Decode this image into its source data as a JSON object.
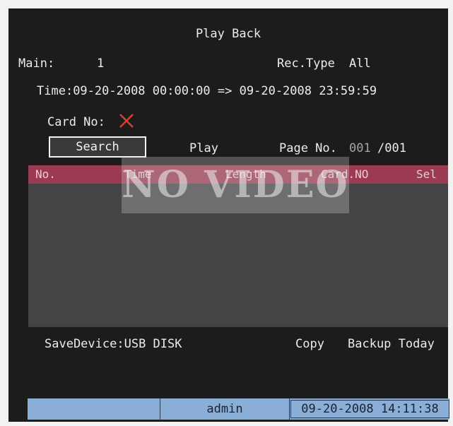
{
  "screen": {
    "title": "Play Back",
    "main_label": "Main:",
    "main_value": "1",
    "rec_type_label": "Rec.Type",
    "rec_type_value": "All",
    "time_label": "Time:",
    "time_start": "09-20-2008 00:00:00",
    "time_arrow": "=>",
    "time_end": "09-20-2008 23:59:59",
    "card_label": "Card No:",
    "card_state_icon": "close-icon",
    "card_state_color": "#d8412f"
  },
  "toolbar": {
    "search_label": "Search",
    "play_label": "Play",
    "page_label": "Page No.",
    "page_current": "001",
    "page_separator": "/001"
  },
  "table": {
    "accent_color": "#9b3a50",
    "columns": [
      "No.",
      "Time",
      "Length",
      "Card.NO",
      "Sel"
    ],
    "rows": []
  },
  "overlay": {
    "text": "NO VIDEO"
  },
  "footer": {
    "save_device_label": "SaveDevice:",
    "save_device_value": "USB DISK",
    "copy_label": "Copy",
    "backup_label": "Backup Today"
  },
  "status_bar": {
    "user": "admin",
    "datetime": "09-20-2008 14:11:38",
    "color": "#8aaed6"
  }
}
